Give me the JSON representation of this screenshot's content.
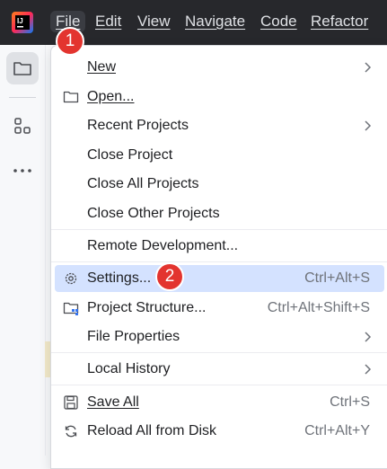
{
  "menubar": {
    "items": [
      "File",
      "Edit",
      "View",
      "Navigate",
      "Code",
      "Refactor"
    ],
    "active": "File",
    "logo_text": "IJ"
  },
  "toolstrip": {
    "items": [
      {
        "name": "project-folder-icon",
        "selected": true
      },
      {
        "name": "structure-icon",
        "selected": false
      },
      {
        "name": "more-icon",
        "selected": false
      }
    ]
  },
  "file_menu": {
    "items": [
      {
        "label": "New",
        "mnemonic": "N",
        "submenu": true,
        "icon": ""
      },
      {
        "label": "Open...",
        "mnemonic": "O",
        "icon": "folder-icon"
      },
      {
        "label": "Recent Projects",
        "mnemonic": "R",
        "submenu": true
      },
      {
        "label": "Close Project"
      },
      {
        "label": "Close All Projects"
      },
      {
        "label": "Close Other Projects"
      },
      {
        "label": "Remote Development..."
      },
      {
        "label": "Settings...",
        "icon": "gear-icon",
        "shortcut": "Ctrl+Alt+S",
        "highlighted": true
      },
      {
        "label": "Project Structure...",
        "icon": "project-structure-icon",
        "shortcut": "Ctrl+Alt+Shift+S"
      },
      {
        "label": "File Properties",
        "submenu": true
      },
      {
        "label": "Local History",
        "mnemonic": "H",
        "submenu": true
      },
      {
        "label": "Save All",
        "mnemonic": "S",
        "icon": "save-icon",
        "shortcut": "Ctrl+S"
      },
      {
        "label": "Reload All from Disk",
        "icon": "reload-icon",
        "shortcut": "Ctrl+Alt+Y"
      }
    ]
  },
  "badges": {
    "one": "1",
    "two": "2"
  },
  "colors": {
    "menubar_bg": "#27282c",
    "highlight": "#d4e2ff",
    "badge": "#e3342f"
  }
}
